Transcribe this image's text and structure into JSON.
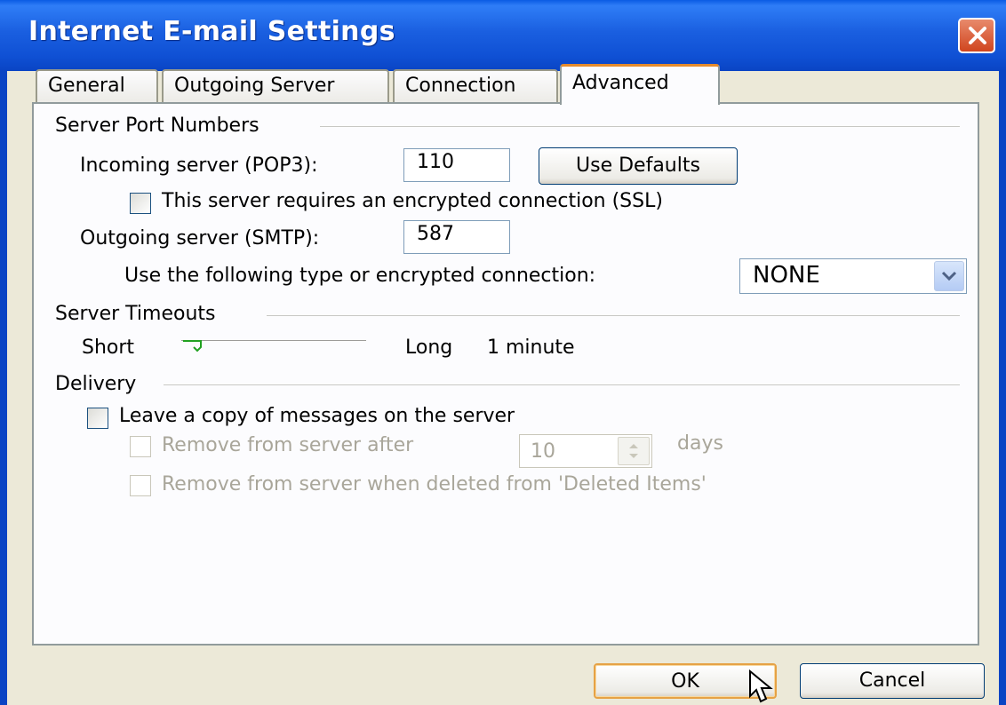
{
  "window": {
    "title": "Internet E-mail Settings"
  },
  "tabs": [
    {
      "label": "General"
    },
    {
      "label": "Outgoing Server"
    },
    {
      "label": "Connection"
    },
    {
      "label": "Advanced",
      "active": true
    }
  ],
  "server_ports": {
    "group_label": "Server Port Numbers",
    "incoming_label": "Incoming server (POP3):",
    "incoming_value": "110",
    "use_defaults_label": "Use Defaults",
    "ssl_label": "This server requires an encrypted connection (SSL)",
    "ssl_checked": false,
    "outgoing_label": "Outgoing server (SMTP):",
    "outgoing_value": "587",
    "encryption_label": "Use the following type or encrypted connection:",
    "encryption_value": "NONE"
  },
  "timeouts": {
    "group_label": "Server Timeouts",
    "short_label": "Short",
    "long_label": "Long",
    "value_label": "1 minute",
    "slider_level": 0.0
  },
  "delivery": {
    "group_label": "Delivery",
    "leave_copy_label": "Leave a copy of messages on the server",
    "leave_copy_checked": false,
    "remove_after_label": "Remove from server after",
    "remove_after_value": "10",
    "days_label": "days",
    "remove_deleted_label": "Remove from server when deleted from 'Deleted Items'"
  },
  "buttons": {
    "ok_label": "OK",
    "cancel_label": "Cancel"
  },
  "colors": {
    "title_bar": "#0a5be4",
    "dialog_bg": "#ece9d8",
    "active_tab_accent": "#e68b2c",
    "close_button": "#d0451e"
  }
}
